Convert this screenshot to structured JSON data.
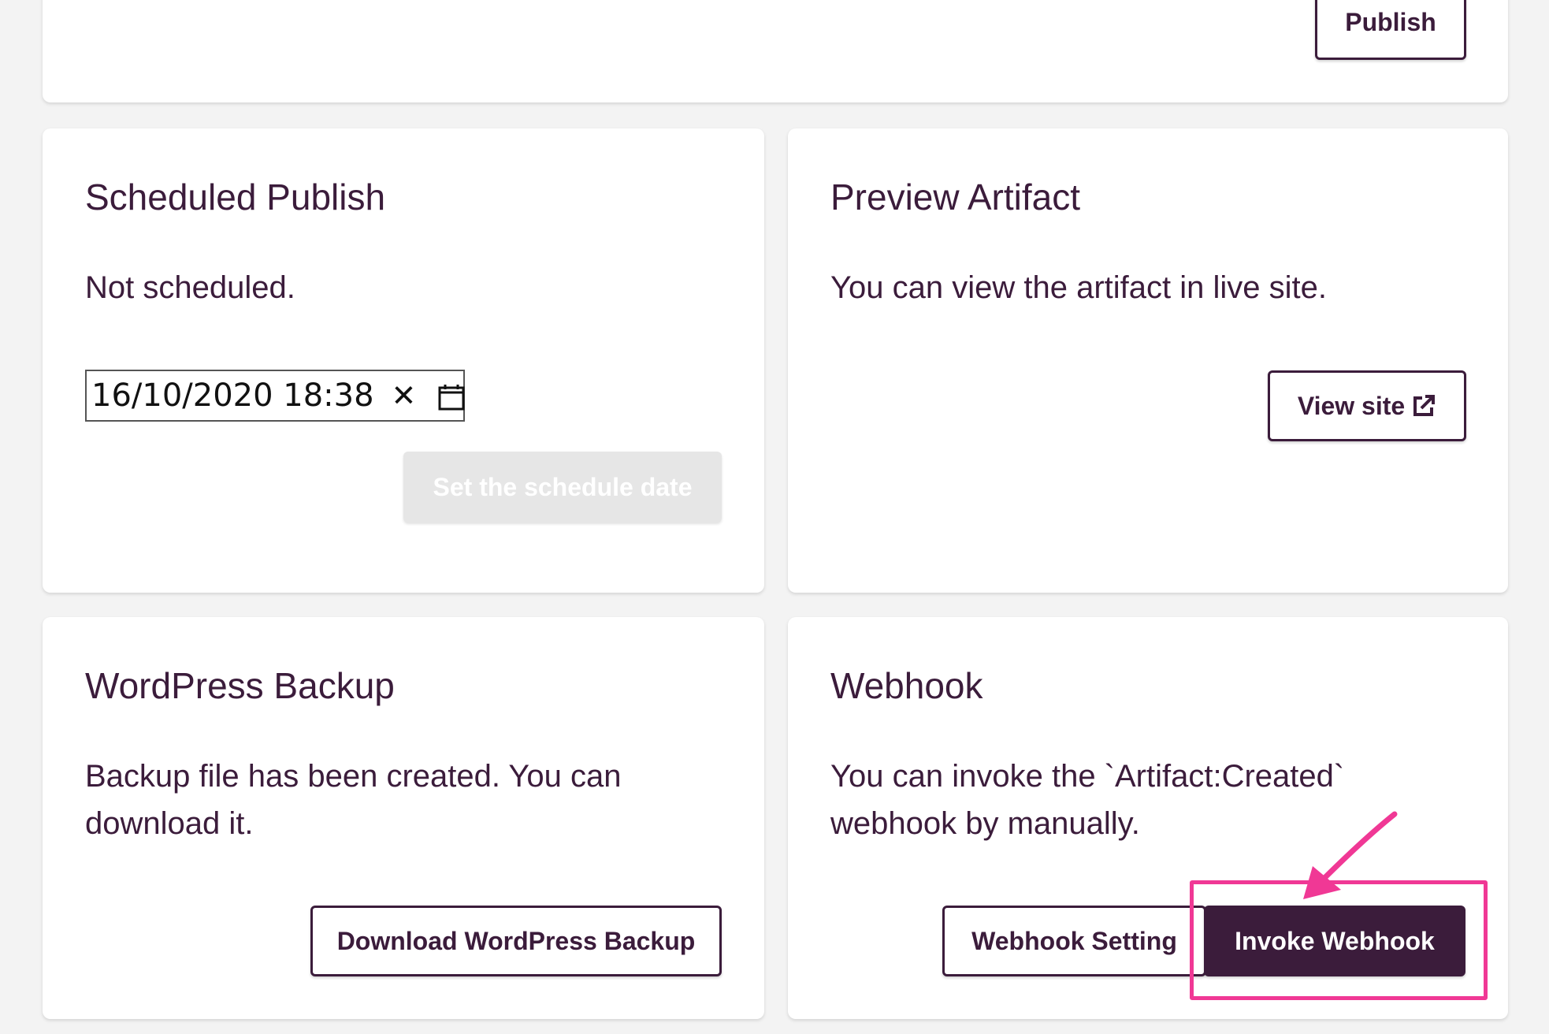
{
  "top_card": {
    "publish_label": "Publish"
  },
  "scheduled_publish": {
    "title": "Scheduled Publish",
    "status": "Not scheduled.",
    "date_value": "16/10/2020 18:38",
    "clear_symbol": "✕",
    "calendar_icon": "calendar-icon",
    "set_button_label": "Set the schedule date"
  },
  "preview_artifact": {
    "title": "Preview Artifact",
    "description": "You can view the artifact in live site.",
    "view_site_label": "View site",
    "external_icon": "external-link-icon"
  },
  "wordpress_backup": {
    "title": "WordPress Backup",
    "description": "Backup file has been created. You can download it.",
    "download_label": "Download WordPress Backup"
  },
  "webhook": {
    "title": "Webhook",
    "description": "You can invoke the `Artifact:Created` webhook by manually.",
    "setting_label": "Webhook Setting",
    "invoke_label": "Invoke Webhook"
  },
  "colors": {
    "primary": "#3b1c3b",
    "highlight": "#f03895",
    "disabled": "#e6e6e6",
    "background": "#f3f3f3"
  }
}
